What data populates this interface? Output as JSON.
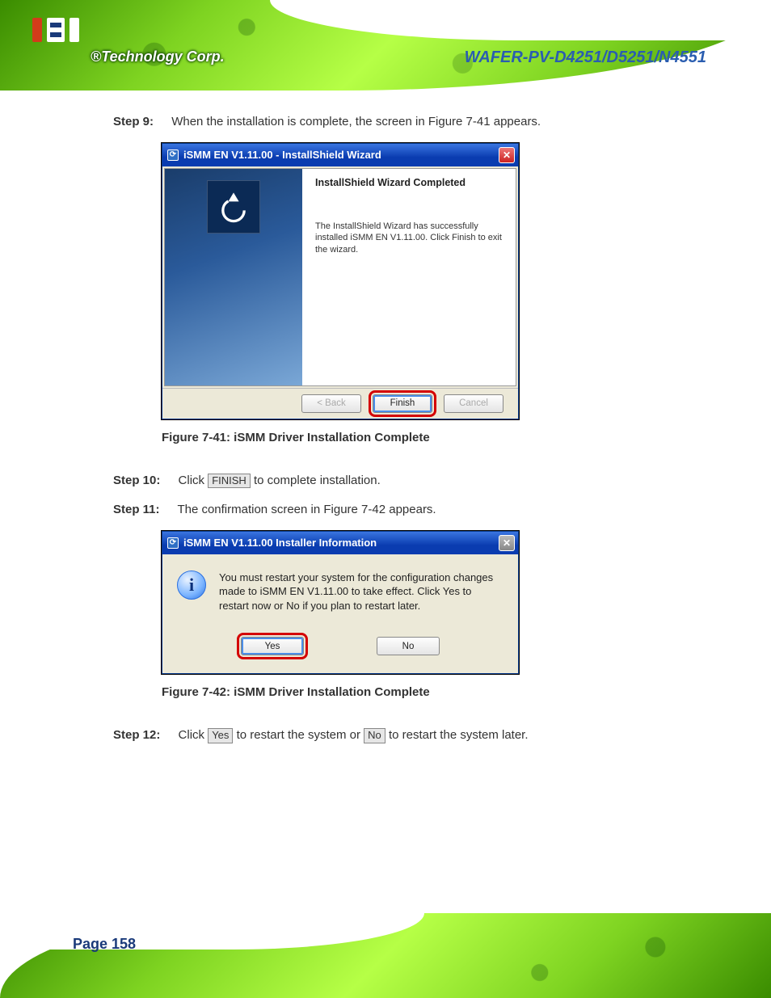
{
  "banner": {
    "logo_tag": "®Technology Corp.",
    "doc_title": "WAFER-PV-D4251/D5251/N4551"
  },
  "steps": {
    "s9": {
      "num": "Step 9:",
      "text": "When the installation is complete, the screen in Figure 7-41 appears."
    },
    "s10": {
      "num": "Step 10:",
      "text_before": "Click ",
      "btn": "FINISH",
      "text_after": " to complete installation."
    },
    "s11": {
      "num": "Step 11:",
      "text_before": "The confirmation screen in Figure 7-42 appears."
    },
    "s12": {
      "num": "Step 12:",
      "text_before": "Click ",
      "btn1": "Yes",
      "text_mid": " to restart the system or ",
      "btn2": "No",
      "text_after": " to restart the system later."
    }
  },
  "fig1": {
    "caption": "Figure 7-41: iSMM Driver Installation Complete"
  },
  "fig2": {
    "caption": "Figure 7-42: iSMM Driver Installation Complete"
  },
  "win1": {
    "title": "iSMM EN V1.11.00 - InstallShield Wizard",
    "heading": "InstallShield Wizard Completed",
    "paragraph": "The InstallShield Wizard has successfully installed iSMM EN V1.11.00. Click Finish to exit the wizard.",
    "back": "< Back",
    "finish": "Finish",
    "cancel": "Cancel"
  },
  "win2": {
    "title": "iSMM EN V1.11.00 Installer Information",
    "message": "You must restart your system for the configuration changes made to iSMM EN V1.11.00 to take effect. Click Yes to restart now or No if you plan to restart later.",
    "yes": "Yes",
    "no": "No"
  },
  "page_number": "Page 158"
}
